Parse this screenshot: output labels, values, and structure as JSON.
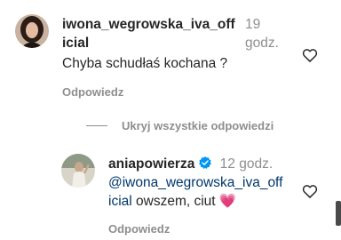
{
  "comment": {
    "username_line1": "iwona_wegrowska_iva_off",
    "username_line2": "icial",
    "time_line1": "19",
    "time_line2": "godz.",
    "text": "Chyba schudłaś kochana ?",
    "reply_label": "Odpowiedz",
    "like_icon": "heart-outline-icon"
  },
  "replies_toggle": {
    "label": "Ukryj wszystkie odpowiedzi"
  },
  "reply": {
    "username": "aniapowierza",
    "verified_icon": "verified-badge-icon",
    "time": "12 godz.",
    "mention_line1": "@iwona_wegrowska_iva_off",
    "mention_line2": "icial",
    "text": " owszem, ciut ",
    "emoji": "💗",
    "reply_label": "Odpowiedz",
    "like_icon": "heart-outline-icon"
  },
  "colors": {
    "text": "#262626",
    "muted": "#8e8e8e",
    "mention": "#00376b",
    "verified": "#0095f6",
    "heart_emoji": "#e0245e"
  }
}
